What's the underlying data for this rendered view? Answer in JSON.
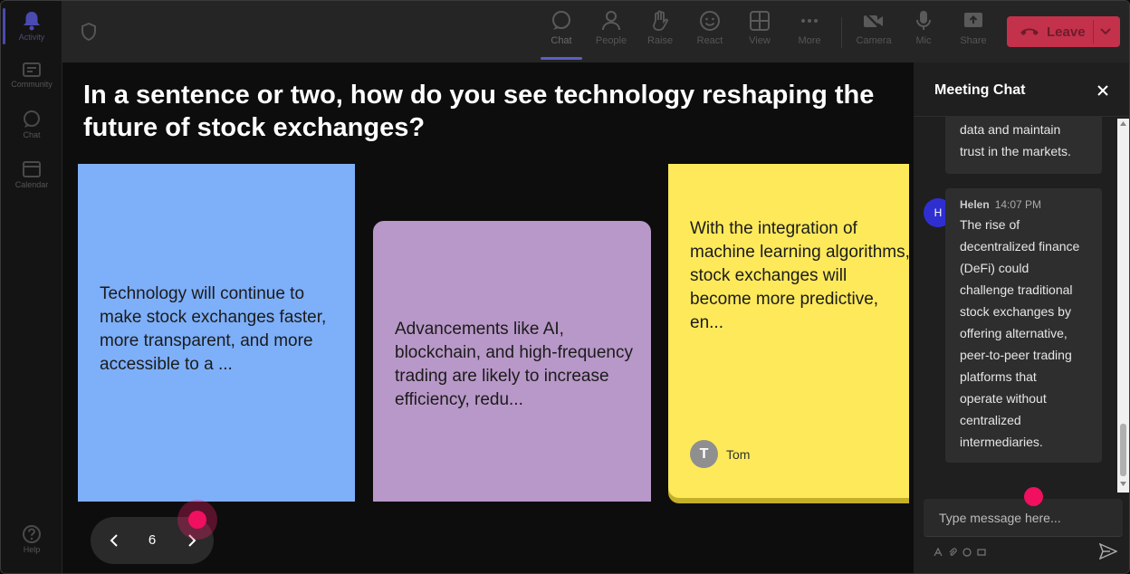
{
  "rail": {
    "items": [
      {
        "label": "Activity",
        "icon": "bell-icon"
      },
      {
        "label": "Community",
        "icon": "community-icon"
      },
      {
        "label": "Chat",
        "icon": "chat-icon"
      },
      {
        "label": "Calendar",
        "icon": "calendar-icon"
      },
      {
        "label": "Help",
        "icon": "help-icon"
      }
    ]
  },
  "toolbar": {
    "chat": "Chat",
    "people": "People",
    "raise": "Raise",
    "react": "React",
    "view": "View",
    "more": "More",
    "camera": "Camera",
    "mic": "Mic",
    "share": "Share",
    "leave": "Leave"
  },
  "stage": {
    "question": "In a sentence or two, how do you see technology reshaping the future of stock exchanges?",
    "cards": [
      {
        "text": "Technology will continue to make stock exchanges faster, more transparent, and more accessible to a ...",
        "color": "#7eaff9"
      },
      {
        "text": "Advancements like AI, blockchain, and high-frequency trading are likely to increase efficiency, redu...",
        "color": "#b898c8"
      },
      {
        "text_lines": [
          "With the integration of",
          "machine learning algorithms,",
          "stock exchanges will",
          "become more predictive,",
          "en..."
        ],
        "color": "#fde95a",
        "author_initial": "T",
        "author": "Tom"
      }
    ],
    "pager": {
      "page": "6"
    }
  },
  "chat": {
    "title": "Meeting Chat",
    "messages": [
      {
        "text_lines": [
          "data and maintain",
          "trust in the markets."
        ]
      },
      {
        "author": "Helen",
        "initial": "H",
        "time": "14:07 PM",
        "text_lines": [
          "The rise of",
          "decentralized finance",
          "(DeFi) could",
          "challenge traditional",
          "stock exchanges by",
          "offering alternative,",
          "peer-to-peer trading",
          "platforms that",
          "operate without",
          "centralized",
          "intermediaries."
        ]
      }
    ],
    "input_placeholder": "Type message here..."
  }
}
